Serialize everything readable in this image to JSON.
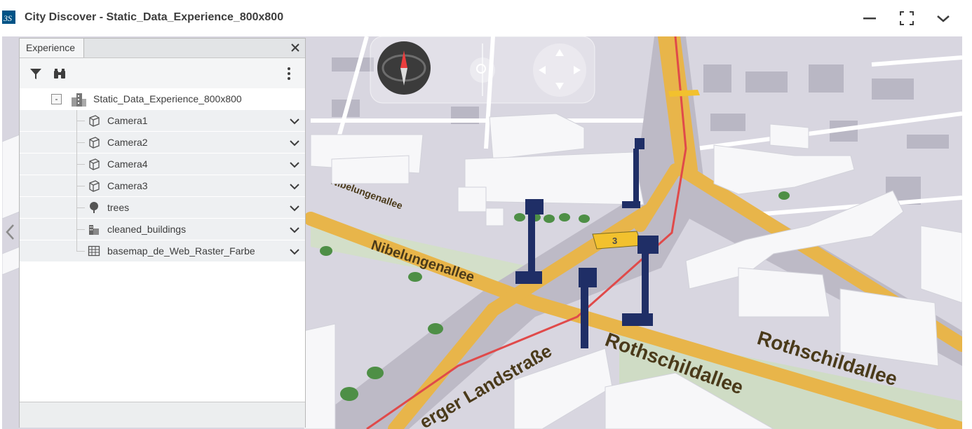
{
  "window": {
    "title": "City Discover - Static_Data_Experience_800x800",
    "controls": [
      "minimize-icon",
      "fullscreen-icon",
      "chevron-down-icon"
    ]
  },
  "panel": {
    "tab_label": "Experience",
    "toolbar": [
      "filter-icon",
      "binoculars-icon",
      "more-vertical-icon"
    ],
    "root": {
      "label": "Static_Data_Experience_800x800",
      "expander": "-",
      "icon": "city-icon"
    },
    "items": [
      {
        "label": "Camera1",
        "icon": "cube-icon"
      },
      {
        "label": "Camera2",
        "icon": "cube-icon"
      },
      {
        "label": "Camera4",
        "icon": "cube-icon"
      },
      {
        "label": "Camera3",
        "icon": "cube-icon"
      },
      {
        "label": "trees",
        "icon": "tree-icon"
      },
      {
        "label": "cleaned_buildings",
        "icon": "buildings-icon"
      },
      {
        "label": "basemap_de_Web_Raster_Farbe",
        "icon": "raster-map-icon"
      }
    ]
  },
  "map": {
    "street_labels": [
      "Nibelungenallee",
      "Nibelungenallee",
      "Rothschildallee",
      "Rothschildallee",
      "erger Landstraße"
    ],
    "road_shield": "3",
    "navigation": [
      "compass-icon",
      "zoom-icon",
      "pan-control-icon"
    ],
    "colors": {
      "road_major": "#e8b54a",
      "tram_line": "#e04a4a",
      "building": "#f7f7f9",
      "camera_post": "#1f2e66",
      "tree": "#4e8f46",
      "green_area": "#cfdcc5"
    }
  }
}
